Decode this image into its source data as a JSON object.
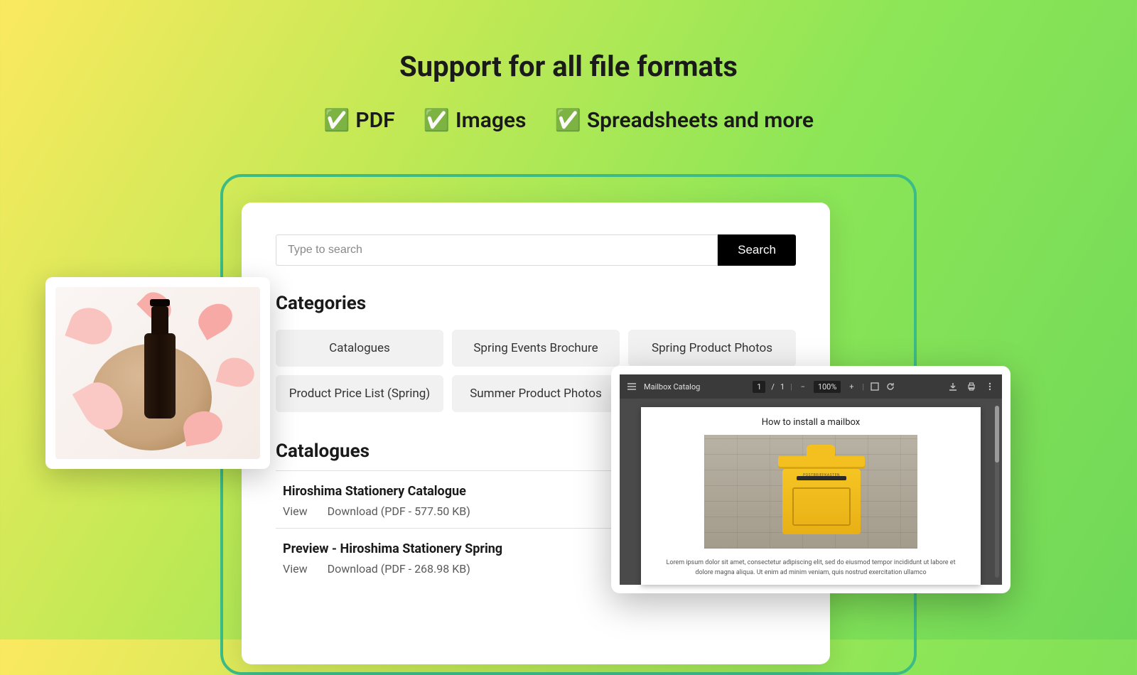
{
  "headline": "Support for all file formats",
  "features": [
    {
      "label": "PDF"
    },
    {
      "label": "Images"
    },
    {
      "label": "Spreadsheets and more"
    }
  ],
  "check_glyph": "✅",
  "search": {
    "placeholder": "Type to search",
    "button_label": "Search"
  },
  "categories_title": "Categories",
  "categories": [
    "Catalogues",
    "Spring Events Brochure",
    "Spring Product Photos",
    "Product Price List (Spring)",
    "Summer Product Photos"
  ],
  "files_section_title": "Catalogues",
  "files": [
    {
      "name": "Hiroshima Stationery Catalogue",
      "view_label": "View",
      "download_label": "Download (PDF - 577.50 KB)"
    },
    {
      "name": "Preview - Hiroshima Stationery Spring",
      "view_label": "View",
      "download_label": "Download (PDF - 268.98 KB)"
    }
  ],
  "pdf_viewer": {
    "doc_name": "Mailbox Catalog",
    "page_current": "1",
    "page_sep": "/",
    "page_total": "1",
    "zoom_label": "100%",
    "minus": "−",
    "plus": "+",
    "doc_title": "How to install a mailbox",
    "mailbox_label": "POSTBRIEFKASTEN",
    "lorem": "Lorem ipsum dolor sit amet, consectetur adipiscing elit, sed do eiusmod tempor incididunt ut labore et dolore magna aliqua. Ut enim ad minim veniam, quis nostrud exercitation ullamco"
  }
}
